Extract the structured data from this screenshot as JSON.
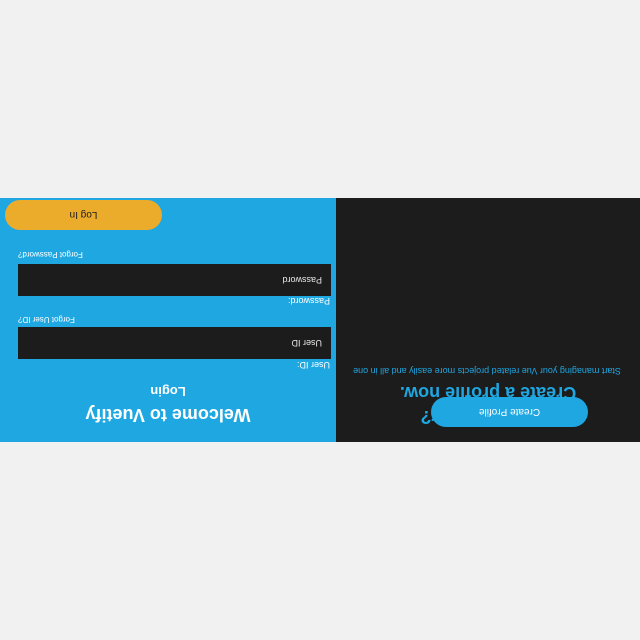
{
  "login_panel": {
    "title": "Welcome to Vuetify",
    "subtitle": "Login",
    "user_id_label": "User ID:",
    "user_id_placeholder": "User ID",
    "forgot_user_id": "Forgot User ID?",
    "password_label": "Password:",
    "password_placeholder": "Password",
    "forgot_password": "Forgot Password?",
    "login_button": "Log In"
  },
  "signup_panel": {
    "title": "First time user?",
    "subtitle": "Create a profile now.",
    "description": "Start managing your Vue related projects more easily and all in one",
    "create_button": "Create Profile"
  },
  "colors": {
    "background": "#f1f1f1",
    "blue_panel": "#1fa7e1",
    "dark_panel": "#1c1c1d",
    "login_button": "#ebab2b",
    "text_white": "#ffffff"
  },
  "display": {
    "orientation": "upside-down"
  }
}
